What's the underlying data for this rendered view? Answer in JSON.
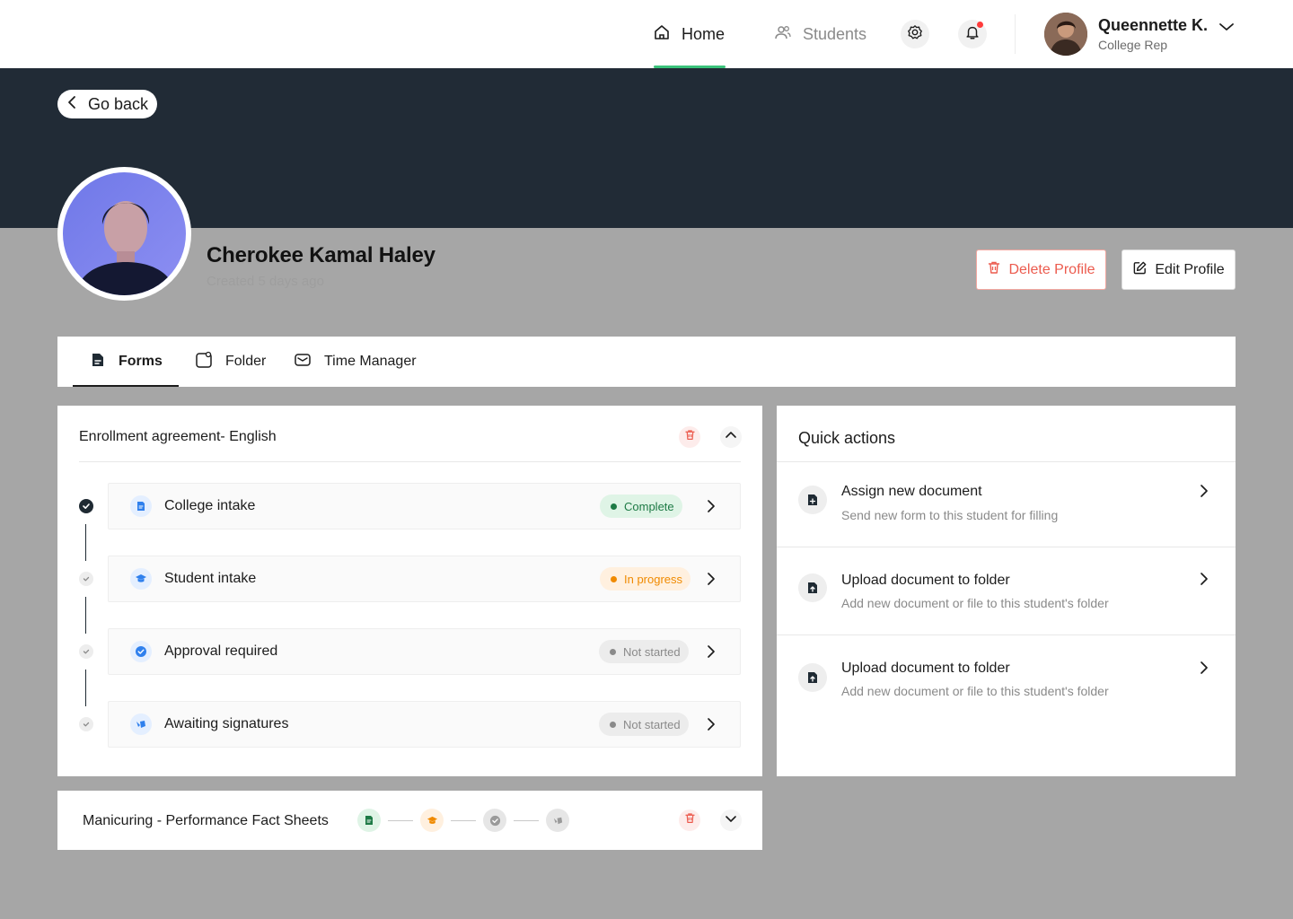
{
  "nav": {
    "home_label": "Home",
    "students_label": "Students",
    "user": {
      "name": "Queennette K.",
      "role": "College Rep"
    }
  },
  "header": {
    "go_back_label": "Go back",
    "profile_name": "Cherokee Kamal Haley",
    "profile_created": "Created 5 days ago",
    "delete_label": "Delete Profile",
    "edit_label": "Edit Profile"
  },
  "tabs": [
    {
      "label": "Forms",
      "active": true,
      "icon": "form-icon"
    },
    {
      "label": "Folder",
      "active": false,
      "icon": "folder-icon"
    },
    {
      "label": "Time Manager",
      "active": false,
      "icon": "mail-icon"
    }
  ],
  "enrollment": {
    "title": "Enrollment agreement- English",
    "forms": [
      {
        "label": "College intake",
        "status": "Complete",
        "icon": "document-icon"
      },
      {
        "label": "Student intake",
        "status": "In progress",
        "icon": "graduation-cap-icon"
      },
      {
        "label": "Approval required",
        "status": "Not started",
        "icon": "check-badge-icon"
      },
      {
        "label": "Awaiting signatures",
        "status": "Not started",
        "icon": "signature-icon"
      }
    ]
  },
  "quick_actions": {
    "title": "Quick actions",
    "items": [
      {
        "title": "Assign new document",
        "desc": "Send new form to this student for filling"
      },
      {
        "title": "Upload document to folder",
        "desc": "Add new document or file to this student's folder"
      },
      {
        "title": "Upload document to folder",
        "desc": "Add new document or file to this student's folder"
      }
    ]
  },
  "manicuring": {
    "title": "Manicuring - Performance Fact Sheets"
  },
  "colors": {
    "accent_green": "#3ac27a",
    "banner": "#212b36",
    "danger": "#ec5b4e",
    "progress": "#f08a00"
  }
}
